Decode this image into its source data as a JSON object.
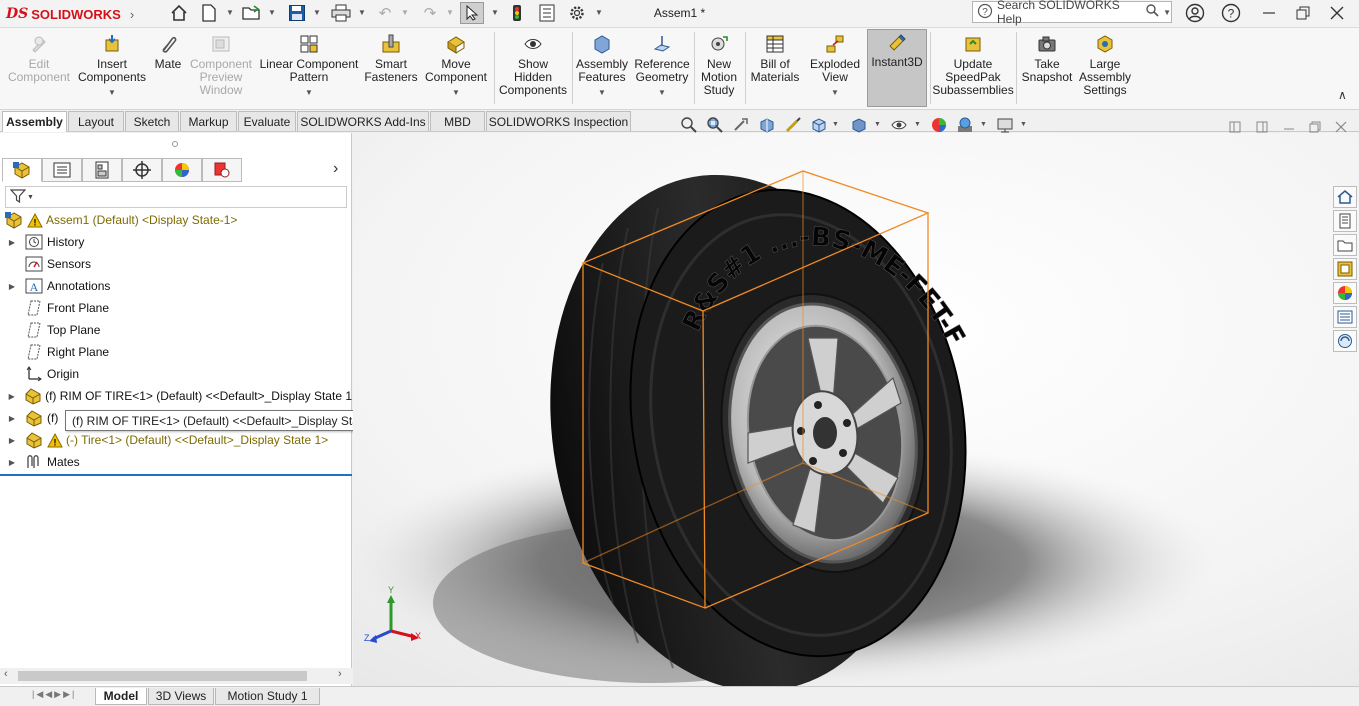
{
  "app": {
    "logo_prefix": "DS",
    "logo_text": "SOLIDWORKS",
    "document_title": "Assem1 *",
    "search_placeholder": "Search SOLIDWORKS Help"
  },
  "ribbon": {
    "buttons": [
      {
        "label": "Edit\nComponent",
        "disabled": true
      },
      {
        "label": "Insert\nComponents",
        "disabled": false
      },
      {
        "label": "Mate",
        "disabled": false
      },
      {
        "label": "Component\nPreview\nWindow",
        "disabled": true
      },
      {
        "label": "Linear Component\nPattern",
        "disabled": false
      },
      {
        "label": "Smart\nFasteners",
        "disabled": false
      },
      {
        "label": "Move\nComponent",
        "disabled": false
      },
      {
        "label": "Show\nHidden\nComponents",
        "disabled": false
      },
      {
        "label": "Assembly\nFeatures",
        "disabled": false
      },
      {
        "label": "Reference\nGeometry",
        "disabled": false
      },
      {
        "label": "New\nMotion\nStudy",
        "disabled": false
      },
      {
        "label": "Bill of\nMaterials",
        "disabled": false
      },
      {
        "label": "Exploded\nView",
        "disabled": false
      },
      {
        "label": "Instant3D",
        "disabled": false,
        "active": true
      },
      {
        "label": "Update\nSpeedPak\nSubassemblies",
        "disabled": false
      },
      {
        "label": "Take\nSnapshot",
        "disabled": false
      },
      {
        "label": "Large\nAssembly\nSettings",
        "disabled": false
      }
    ]
  },
  "command_tabs": [
    "Assembly",
    "Layout",
    "Sketch",
    "Markup",
    "Evaluate",
    "SOLIDWORKS Add-Ins",
    "MBD",
    "SOLIDWORKS Inspection"
  ],
  "tree": {
    "root": "Assem1 (Default) <Display State-1>",
    "items": [
      {
        "label": "History"
      },
      {
        "label": "Sensors"
      },
      {
        "label": "Annotations"
      },
      {
        "label": "Front Plane"
      },
      {
        "label": "Top Plane"
      },
      {
        "label": "Right Plane"
      },
      {
        "label": "Origin"
      },
      {
        "label": "(f) RIM  OF TIRE<1> (Default) <<Default>_Display State 1"
      },
      {
        "label": "(f)"
      },
      {
        "label": "(-) Tire<1> (Default) <<Default>_Display State 1>"
      },
      {
        "label": "Mates"
      }
    ],
    "tooltip": "(f) RIM  OF TIRE<1> (Default) <<Default>_Display State 1>"
  },
  "bottom_tabs": [
    "Model",
    "3D Views",
    "Motion Study 1"
  ],
  "viewport": {
    "tire_text": "R&S#1 ...-BS-ME-FET-F23-SECTION-B",
    "triad": {
      "x": "X",
      "y": "Y",
      "z": "Z"
    }
  },
  "colors": {
    "accent": "#1e73c0",
    "brand_red": "#d3111a",
    "bbox_orange": "#f08a24",
    "warning": "#f2c200"
  }
}
